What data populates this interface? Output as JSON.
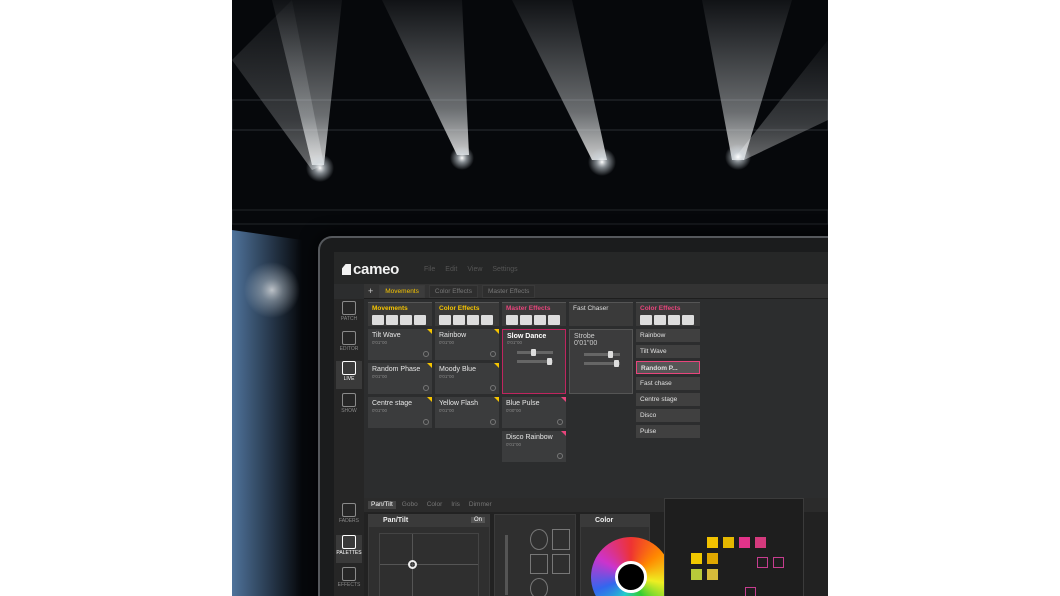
{
  "app": {
    "logo": "cameo",
    "menu": [
      "File",
      "Edit",
      "View",
      "Settings"
    ]
  },
  "tabs": [
    "Movements",
    "Color Effects",
    "Master Effects"
  ],
  "sidebar": [
    "PATCH",
    "EDITOR",
    "LIVE",
    "SHOW",
    "FADERS",
    "PALETTES",
    "EFFECTS"
  ],
  "columns": [
    {
      "title": "Movements",
      "color": "#f5c400",
      "cells": [
        {
          "name": "Tilt Wave",
          "time": "0'01\"00"
        },
        {
          "name": "Random Phase",
          "time": "0'01\"00"
        },
        {
          "name": "Centre stage",
          "time": "0'01\"00"
        }
      ]
    },
    {
      "title": "Color Effects",
      "color": "#f5c400",
      "cells": [
        {
          "name": "Rainbow",
          "time": "0'01\"00"
        },
        {
          "name": "Moody Blue",
          "time": "0'01\"00"
        },
        {
          "name": "Yellow Flash",
          "time": "0'01\"00"
        }
      ]
    },
    {
      "title": "Master Effects",
      "color": "#e8457c",
      "selected": {
        "name": "Slow Dance",
        "time": "0'01\"00"
      },
      "cells": [
        {
          "name": "Blue Pulse",
          "time": "0'00\"00"
        },
        {
          "name": "Disco Rainbow",
          "time": "0'01\"00"
        }
      ]
    },
    {
      "title": "Fast Chaser",
      "color": "#dddddd",
      "cells": [
        {
          "name": "Strobe",
          "time": "0'01\"00"
        }
      ]
    }
  ],
  "list_column": {
    "title": "Color Effects",
    "items": [
      "Rainbow",
      "Tilt Wave",
      "Random P...",
      "Fast chase",
      "Centre stage",
      "Disco",
      "Pulse"
    ],
    "highlighted": "Random P..."
  },
  "lower": {
    "tabs": [
      "Pan/Tilt",
      "Gobo",
      "Color",
      "Iris",
      "Dimmer"
    ],
    "pan_tilt_title": "Pan/Tilt",
    "on_label": "On",
    "color_title": "Color",
    "swatches": [
      "#f2c200",
      "#e5b800",
      "#e3338a",
      "#d43a7d",
      "#f0c800",
      "#e0a800",
      "#b8c93a",
      "#d6bc3a"
    ]
  }
}
